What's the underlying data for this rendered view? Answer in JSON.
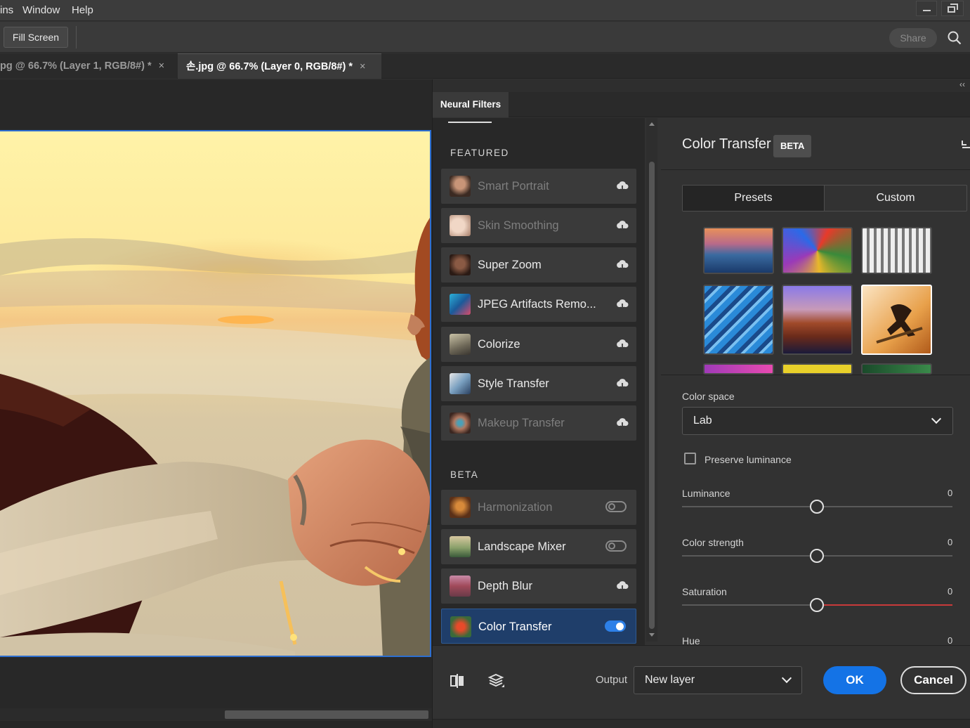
{
  "menubar": {
    "items": [
      "ins",
      "Window",
      "Help"
    ]
  },
  "options_bar": {
    "fill_screen_label": "Fill Screen",
    "share_label": "Share"
  },
  "doc_tabs": [
    {
      "label": "pg @ 66.7% (Layer 1, RGB/8#) *",
      "close": "×",
      "active": false
    },
    {
      "label": "손.jpg @ 66.7% (Layer 0, RGB/8#) *",
      "close": "×",
      "active": true
    }
  ],
  "neural_filters": {
    "panel_title": "Neural Filters",
    "collapse_glyph": "‹‹",
    "sections": {
      "featured": "FEATURED",
      "beta": "BETA"
    },
    "featured_filters": [
      {
        "label": "Smart Portrait",
        "state": "cloud",
        "dim": true
      },
      {
        "label": "Skin Smoothing",
        "state": "cloud",
        "dim": true
      },
      {
        "label": "Super Zoom",
        "state": "cloud",
        "dim": false
      },
      {
        "label": "JPEG Artifacts Remo...",
        "state": "cloud",
        "dim": false
      },
      {
        "label": "Colorize",
        "state": "cloud",
        "dim": false
      },
      {
        "label": "Style Transfer",
        "state": "cloud",
        "dim": false
      },
      {
        "label": "Makeup Transfer",
        "state": "cloud",
        "dim": true
      }
    ],
    "beta_filters": [
      {
        "label": "Harmonization",
        "state": "toggle-off",
        "dim": true
      },
      {
        "label": "Landscape Mixer",
        "state": "toggle-off",
        "dim": false
      },
      {
        "label": "Depth Blur",
        "state": "cloud",
        "dim": false
      },
      {
        "label": "Color Transfer",
        "state": "toggle-on",
        "dim": false,
        "selected": true
      }
    ],
    "detail": {
      "title": "Color Transfer",
      "badge": "BETA",
      "segments": [
        "Presets",
        "Custom"
      ],
      "active_segment": "Presets",
      "color_space_label": "Color space",
      "color_space_value": "Lab",
      "preserve_luminance_label": "Preserve luminance",
      "preserve_luminance_checked": false,
      "sliders": [
        {
          "label": "Luminance",
          "value": "0"
        },
        {
          "label": "Color strength",
          "value": "0"
        },
        {
          "label": "Saturation",
          "value": "0"
        },
        {
          "label": "Hue",
          "value": "0"
        }
      ]
    },
    "footer": {
      "output_label": "Output",
      "output_value": "New layer",
      "ok_label": "OK",
      "cancel_label": "Cancel"
    }
  },
  "colors": {
    "accent_blue": "#1473e6",
    "selected_item_bg": "#1f3e6a",
    "canvas_border": "#2d6fd1"
  }
}
